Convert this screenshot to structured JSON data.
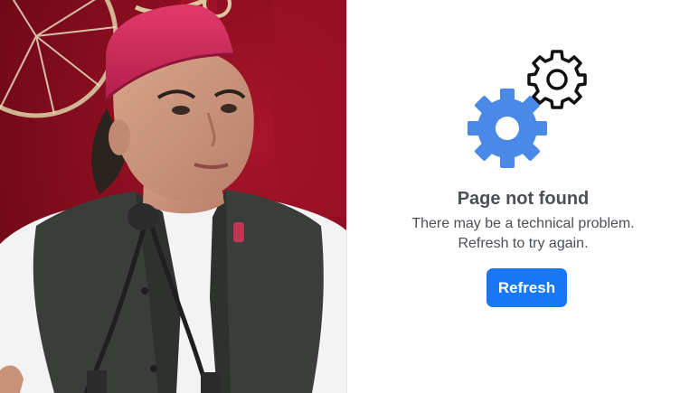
{
  "error": {
    "title": "Page not found",
    "message_line1": "There may be a technical problem.",
    "message_line2": "Refresh to try again.",
    "refresh_label": "Refresh"
  },
  "icons": {
    "large_gear": "gear-icon",
    "small_gear": "gear-outline-icon"
  },
  "colors": {
    "accent": "#1877f2",
    "gear_blue": "#4a89e8",
    "text": "#4b4f56",
    "photo_backdrop": "#8b0e1f"
  }
}
